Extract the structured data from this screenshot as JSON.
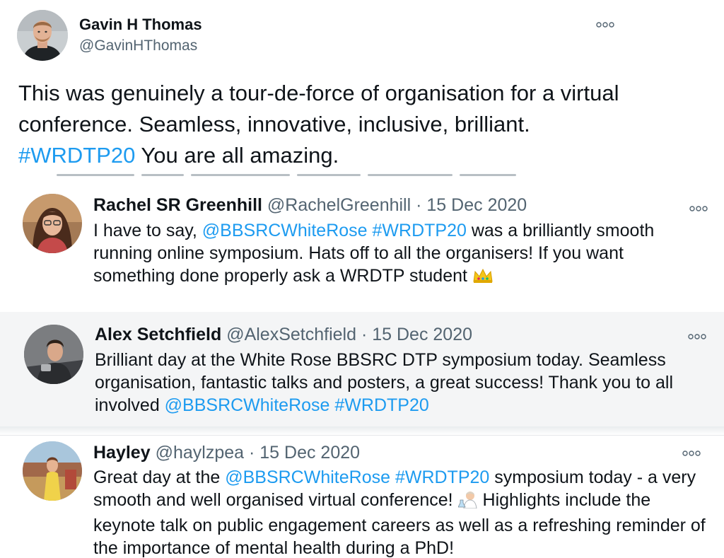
{
  "main_tweet": {
    "name": "Gavin H Thomas",
    "handle": "@GavinHThomas",
    "text_1": "This was genuinely a tour-de-force of organisation for a virtual conference. Seamless, innovative, inclusive, brilliant. ",
    "hashtag": "#WRDTP20",
    "text_2": " You are all amazing."
  },
  "quoted": [
    {
      "name": "Rachel SR Greenhill",
      "handle": "@RachelGreenhill",
      "separator": "·",
      "date": "15 Dec 2020",
      "text_a": "I have to say, ",
      "mention": "@BBSRCWhiteRose",
      "space": " ",
      "hashtag": "#WRDTP20",
      "text_b": " was a brilliantly smooth running online symposium. Hats off to all the organisers! If you want something done properly ask a WRDTP student ",
      "emoji": "crown-emoji"
    },
    {
      "name": "Alex Setchfield",
      "handle": "@AlexSetchfield",
      "separator": "·",
      "date": "15 Dec 2020",
      "text_a": "Brilliant day at the White Rose BBSRC DTP symposium today. Seamless organisation, fantastic talks and posters, a great success! Thank you to all involved ",
      "mention": "@BBSRCWhiteRose",
      "space": " ",
      "hashtag": "#WRDTP20"
    },
    {
      "name": "Hayley",
      "handle": "@haylzpea",
      "separator": "·",
      "date": "15 Dec 2020",
      "text_a": "Great day at the ",
      "mention": "@BBSRCWhiteRose",
      "space": " ",
      "hashtag": "#WRDTP20",
      "text_b": " symposium today - a very smooth and well organised virtual conference! ",
      "emoji": "scientist-emoji",
      "text_c": " Highlights include the keynote talk on public engagement careers as well as a refreshing reminder of the importance of mental health during a PhD!"
    }
  ],
  "colors": {
    "link": "#1d9bf0",
    "secondary_text": "#536471",
    "highlight_bg": "#f4f5f6"
  },
  "icons": [
    "more-options-icon",
    "crown-emoji",
    "scientist-emoji"
  ]
}
